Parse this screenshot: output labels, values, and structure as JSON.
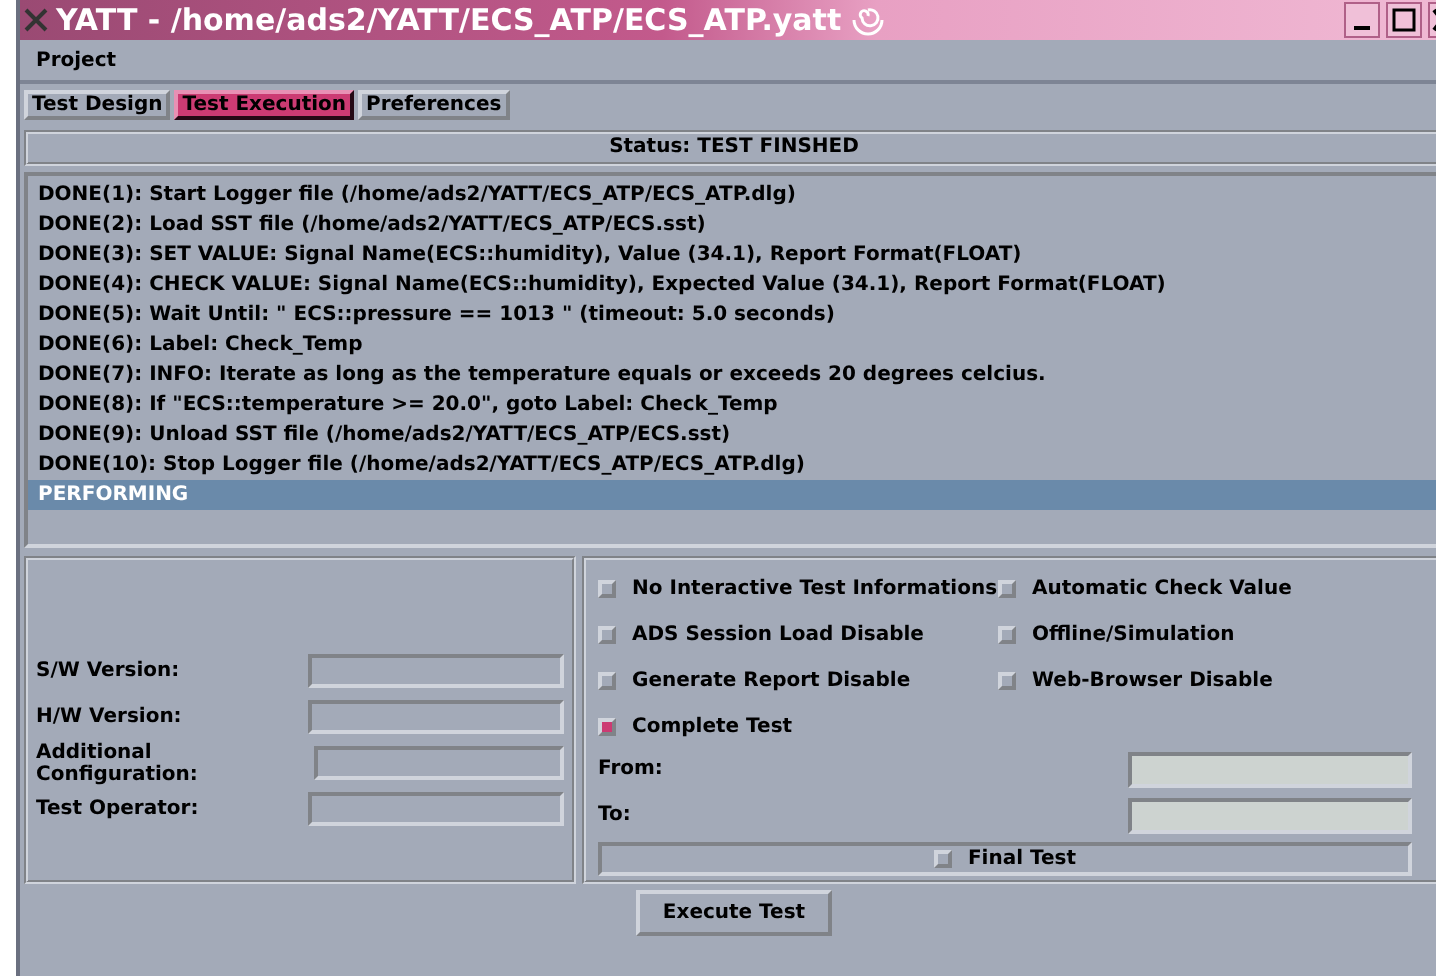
{
  "window": {
    "title": "YATT - /home/ads2/YATT/ECS_ATP/ECS_ATP.yatt"
  },
  "menu": [
    "Project"
  ],
  "tabs": [
    {
      "label": "Test Design",
      "selected": false
    },
    {
      "label": "Test Execution",
      "selected": true
    },
    {
      "label": "Preferences",
      "selected": false
    }
  ],
  "status": "Status:  TEST FINSHED",
  "log": [
    {
      "text": "DONE(1): Start Logger file (/home/ads2/YATT/ECS_ATP/ECS_ATP.dlg)",
      "selected": false
    },
    {
      "text": "DONE(2): Load SST file (/home/ads2/YATT/ECS_ATP/ECS.sst)",
      "selected": false
    },
    {
      "text": "DONE(3): SET VALUE: Signal Name(ECS::humidity), Value (34.1), Report Format(FLOAT)",
      "selected": false
    },
    {
      "text": "DONE(4): CHECK VALUE: Signal Name(ECS::humidity), Expected Value (34.1), Report Format(FLOAT)",
      "selected": false
    },
    {
      "text": "DONE(5): Wait Until: \" ECS::pressure == 1013 \" (timeout: 5.0 seconds)",
      "selected": false
    },
    {
      "text": "DONE(6): Label:  Check_Temp",
      "selected": false
    },
    {
      "text": "DONE(7): INFO: Iterate as long as the temperature equals or exceeds 20 degrees celcius.",
      "selected": false
    },
    {
      "text": "DONE(8): If \"ECS::temperature >= 20.0\", goto Label: Check_Temp",
      "selected": false
    },
    {
      "text": "DONE(9): Unload SST file (/home/ads2/YATT/ECS_ATP/ECS.sst)",
      "selected": false
    },
    {
      "text": "DONE(10): Stop Logger file (/home/ads2/YATT/ECS_ATP/ECS_ATP.dlg)",
      "selected": false
    },
    {
      "text": "PERFORMING",
      "selected": true
    }
  ],
  "fields": [
    {
      "label": "S/W Version:"
    },
    {
      "label": "H/W Version:"
    },
    {
      "label": "Additional Configuration:"
    },
    {
      "label": "Test Operator:"
    }
  ],
  "options": [
    {
      "label": "No Interactive Test Informations",
      "checked": false
    },
    {
      "label": "Automatic Check Value",
      "checked": false
    },
    {
      "label": "ADS Session Load Disable",
      "checked": false
    },
    {
      "label": "Offline/Simulation",
      "checked": false
    },
    {
      "label": "Generate Report Disable",
      "checked": false
    },
    {
      "label": "Web-Browser Disable",
      "checked": false
    },
    {
      "label": "Complete Test",
      "checked": true
    }
  ],
  "range": [
    {
      "label": "From:"
    },
    {
      "label": "To:"
    }
  ],
  "final_test": {
    "label": "Final Test",
    "checked": false
  },
  "execute_button": "Execute Test"
}
